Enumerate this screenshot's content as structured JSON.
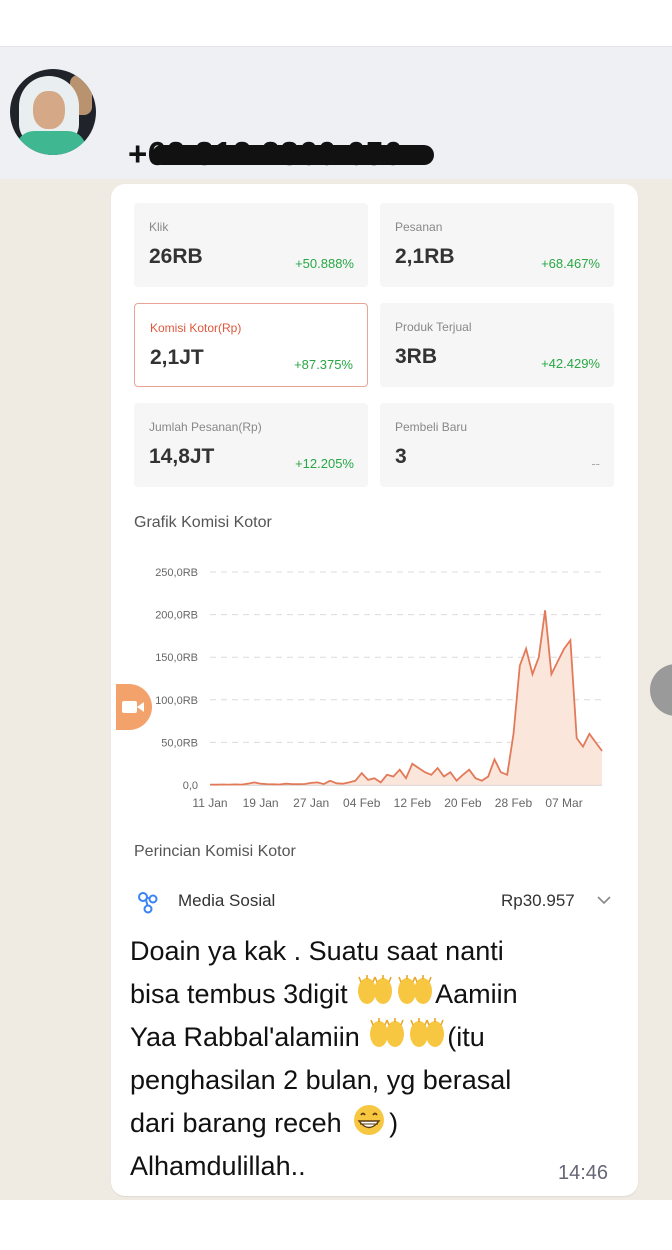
{
  "header": {
    "phone": "+62 812 2860 650"
  },
  "stats": [
    {
      "label": "Klik",
      "value": "26RB",
      "change": "+50.888%"
    },
    {
      "label": "Pesanan",
      "value": "2,1RB",
      "change": "+68.467%"
    },
    {
      "label": "Komisi Kotor(Rp)",
      "value": "2,1JT",
      "change": "+87.375%"
    },
    {
      "label": "Produk Terjual",
      "value": "3RB",
      "change": "+42.429%"
    },
    {
      "label": "Jumlah Pesanan(Rp)",
      "value": "14,8JT",
      "change": "+12.205%"
    },
    {
      "label": "Pembeli Baru",
      "value": "3",
      "change": "--"
    }
  ],
  "chart_title": "Grafik Komisi Kotor",
  "chart_data": {
    "type": "area",
    "title": "Grafik Komisi Kotor",
    "xlabel": "",
    "ylabel": "",
    "ylim": [
      0,
      250000
    ],
    "ytick_labels": [
      "0,0",
      "50,0RB",
      "100,0RB",
      "150,0RB",
      "200,0RB",
      "250,0RB"
    ],
    "xtick_labels": [
      "11 Jan",
      "19 Jan",
      "27 Jan",
      "04 Feb",
      "12 Feb",
      "20 Feb",
      "28 Feb",
      "07 Mar"
    ],
    "grid": true,
    "color": "#e27a5a",
    "x": [
      "11 Jan",
      "12 Jan",
      "13 Jan",
      "14 Jan",
      "15 Jan",
      "16 Jan",
      "17 Jan",
      "18 Jan",
      "19 Jan",
      "20 Jan",
      "21 Jan",
      "22 Jan",
      "23 Jan",
      "24 Jan",
      "25 Jan",
      "26 Jan",
      "27 Jan",
      "28 Jan",
      "29 Jan",
      "30 Jan",
      "31 Jan",
      "01 Feb",
      "02 Feb",
      "03 Feb",
      "04 Feb",
      "05 Feb",
      "06 Feb",
      "07 Feb",
      "08 Feb",
      "09 Feb",
      "10 Feb",
      "11 Feb",
      "12 Feb",
      "13 Feb",
      "14 Feb",
      "15 Feb",
      "16 Feb",
      "17 Feb",
      "18 Feb",
      "19 Feb",
      "20 Feb",
      "21 Feb",
      "22 Feb",
      "23 Feb",
      "24 Feb",
      "25 Feb",
      "26 Feb",
      "27 Feb",
      "28 Feb",
      "01 Mar",
      "02 Mar",
      "03 Mar",
      "04 Mar",
      "05 Mar",
      "06 Mar",
      "07 Mar",
      "08 Mar",
      "09 Mar",
      "10 Mar",
      "11 Mar",
      "12 Mar",
      "13 Mar",
      "14 Mar"
    ],
    "values": [
      500,
      400,
      600,
      500,
      700,
      500,
      1500,
      3000,
      1500,
      1000,
      800,
      600,
      1500,
      1000,
      900,
      1200,
      2500,
      3000,
      1000,
      5000,
      2000,
      1500,
      3000,
      5000,
      14000,
      6000,
      8000,
      3000,
      12000,
      10000,
      18000,
      8000,
      25000,
      20000,
      15000,
      12000,
      20000,
      10000,
      15000,
      5000,
      12000,
      18000,
      8000,
      5000,
      10000,
      30000,
      15000,
      12000,
      60000,
      140000,
      160000,
      130000,
      150000,
      205000,
      130000,
      145000,
      160000,
      170000,
      55000,
      45000,
      60000,
      50000,
      40000
    ]
  },
  "breakdown_title": "Perincian Komisi Kotor",
  "breakdown": {
    "label": "Media Sosial",
    "value": "Rp30.957"
  },
  "message": {
    "line1": "Doain ya kak . Suatu saat nanti",
    "line2a": "bisa tembus 3digit ",
    "line2b": "Aamiin",
    "line3a": "Yaa Rabbal'alamiin ",
    "line3b": "(itu",
    "line4": "penghasilan 2 bulan, yg berasal",
    "line5a": "dari barang receh ",
    "line5b": ")",
    "line6": "Alhamdulillah..",
    "time": "14:46"
  },
  "icons": {
    "hands": "raising-hands-emoji",
    "grin": "grinning-face-emoji",
    "social": "share-nodes-icon",
    "chevron": "chevron-down-icon"
  }
}
